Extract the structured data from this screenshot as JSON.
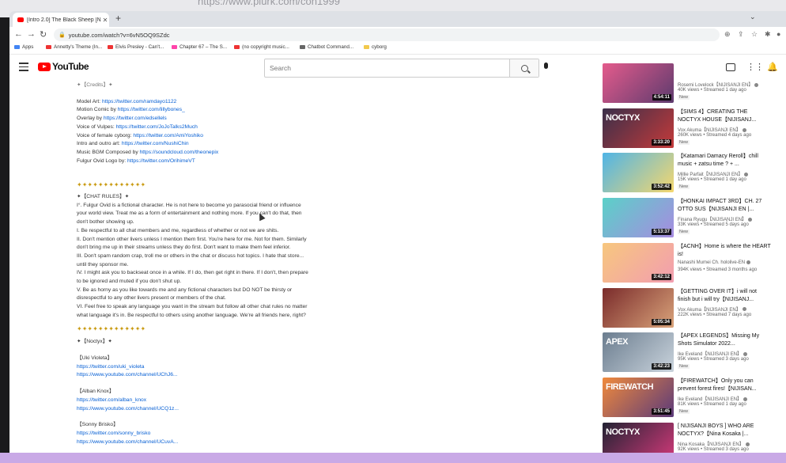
{
  "background_url": "https://www.plurk.com/con1999",
  "browser": {
    "tab_title": "[Intro 2.0] The Black Sheep [Nii...",
    "url": "youtube.com/watch?v=6vN5OQ9SZdc",
    "bookmarks": [
      "Apps",
      "Annetty's Theme (In...",
      "Elvis Presley - Can't...",
      "Chapter 67 – The S...",
      "(no copyright music...",
      "Chatbot Command...",
      "cyborg"
    ]
  },
  "youtube": {
    "logo_text": "YouTube",
    "search_placeholder": "Search"
  },
  "description": {
    "top_heading": "✦【Credits】✦",
    "credits": [
      {
        "label": "Model Art:",
        "link": "https://twitter.com/ramdayo1122"
      },
      {
        "label": "Motion Comic by",
        "link": "https://twitter.com/lillybones_"
      },
      {
        "label": "Overlay by",
        "link": "https://twitter.com/edsellels"
      },
      {
        "label": "Voice of Vulpes:",
        "link": "https://twitter.com/JoJoTalks2Much"
      },
      {
        "label": "Voice of female cyborg:",
        "link": "https://twitter.com/AmiYoshiko"
      },
      {
        "label": "Intro and outro art:",
        "link": "https://twitter.com/NushiChin"
      },
      {
        "label": "Music BGM Composed by",
        "link": "https://soundcloud.com/theonepix"
      },
      {
        "label": "Fulgur Ovid Logo by:",
        "link": "https://twitter.com/OrihimeVT"
      }
    ],
    "separator": "✦✦✦✦✦✦✦✦✦✦✦✦✦",
    "chat_rules_heading": "✦【CHAT RULES】✦",
    "rules": [
      "I°. Fulgur Ovid is a fictional character. He is not here to become yo parasocial friend or influence",
      "your world view. Treat me as a form of entertainment and nothing more. If you can't do that, then",
      "don't bother showing up.",
      "I. Be respectful to all chat members and me, regardless of whether or not we are shits.",
      "II. Don't mention other livers unless I mention them first. You're here for me. Not for them. Similarly",
      "don't bring me up in their streams unless they do first. Don't want to make them feel inferior.",
      "III. Don't spam random crap, troll me or others in the chat or discuss hot topics. I hate that store...",
      "until they sponsor me.",
      "IV. I might ask you to backseat once in a while. If I do, then get right in there. If I don't, then prepare",
      "to be ignored and muted if you don't shut up.",
      "V. Be as horny as you like towards me and any fictional characters but DO NOT be thirsty or",
      "disrespectful to any other livers present or members of the chat.",
      "VI. Feel free to speak any language you want in the stream but follow all other chat rules no matter",
      "what language it's in. Be respectful to others using another language. We're all friends here, right?"
    ],
    "noctyx_heading": "✦【Noctyx】✦",
    "members": [
      {
        "name": "【Uki Violeta】",
        "twitter": "https://twitter.com/uki_violeta",
        "youtube": "https://www.youtube.com/channel/UChJ6..."
      },
      {
        "name": "【Alban Knox】",
        "twitter": "https://twitter.com/alban_knox",
        "youtube": "https://www.youtube.com/channel/UCQ1z..."
      },
      {
        "name": "【Sonny Brisko】",
        "twitter": "https://twitter.com/sonny_brisko",
        "youtube": "https://www.youtube.com/channel/UCuvA..."
      }
    ]
  },
  "recommendations": [
    {
      "title": "",
      "channel": "Rosemi Lovelock【NIJISANJI EN】",
      "meta": "40K views • Streamed 1 day ago",
      "badge": "New",
      "duration": "4:54:11",
      "colors": [
        "#e45b8c",
        "#5d3b6e"
      ]
    },
    {
      "title": "【SIMS 4】CREATING THE NOCTYX HOUSE【NIJISANJ...",
      "channel": "Vox Akuma【NIJISANJI EN】",
      "meta": "260K views • Streamed 4 days ago",
      "badge": "New",
      "duration": "3:33:20",
      "colors": [
        "#3a2f4a",
        "#c43a3a"
      ],
      "word": "NOCTYX"
    },
    {
      "title": "【Katamari Damacy Reroll】chill music + zatsu time ? + ...",
      "channel": "Millie Parfait【NIJISANJI EN】",
      "meta": "15K views • Streamed 1 day ago",
      "badge": "New",
      "duration": "3:52:42",
      "colors": [
        "#4fb4e6",
        "#f5d76e"
      ]
    },
    {
      "title": "【HONKAI IMPACT 3RD】CH. 27 OTTO SUS【NIJISANJI EN |...",
      "channel": "Finana Ryugu【NIJISANJI EN】",
      "meta": "33K views • Streamed 5 days ago",
      "badge": "New",
      "duration": "5:13:37",
      "colors": [
        "#5ad1c8",
        "#a78be0"
      ]
    },
    {
      "title": "【ACNH】Home is where the HEART is!",
      "channel": "Nanashi Mumei Ch. hololive-EN",
      "meta": "394K views • Streamed 3 months ago",
      "badge": "",
      "duration": "3:42:12",
      "colors": [
        "#f7c77e",
        "#f29db0"
      ]
    },
    {
      "title": "【GETTING OVER IT】i will not finish but i will try【NIJISANJ...",
      "channel": "Vox Akuma【NIJISANJI EN】",
      "meta": "222K views • Streamed 7 days ago",
      "badge": "",
      "duration": "5:05:34",
      "colors": [
        "#7a2b2b",
        "#d9a37a"
      ]
    },
    {
      "title": "【APEX LEGENDS】Missing My Shots Simulator 2022...",
      "channel": "Ike Eveland【NIJISANJI EN】",
      "meta": "95K views • Streamed 3 days ago",
      "badge": "New",
      "duration": "3:42:23",
      "colors": [
        "#6b7d8f",
        "#c9d3dc"
      ],
      "word": "APEX"
    },
    {
      "title": "【FIREWATCH】Only you can prevent forest fires!【NIJISAN...",
      "channel": "Ike Eveland【NIJISANJI EN】",
      "meta": "81K views • Streamed 1 day ago",
      "badge": "New",
      "duration": "3:51:45",
      "colors": [
        "#f08a3c",
        "#5b3a7a"
      ],
      "word": "FIREWATCH"
    },
    {
      "title": "[ NIJISANJI BOYS ] WHO ARE NOCTYX?【Nina Kosaka |...",
      "channel": "Nina Kosaka【NIJISANJI EN】",
      "meta": "92K views • Streamed 3 days ago",
      "badge": "New",
      "duration": "",
      "colors": [
        "#222233",
        "#d33a7a"
      ],
      "word": "NOCTYX"
    }
  ]
}
